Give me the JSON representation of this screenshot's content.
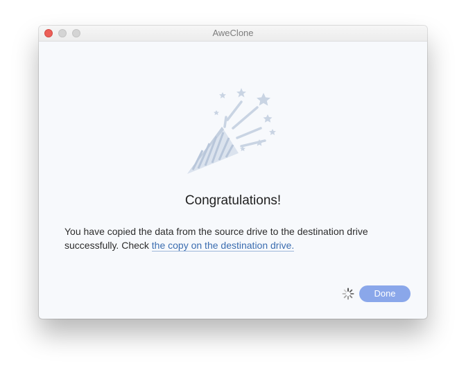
{
  "window": {
    "title": "AweClone"
  },
  "content": {
    "illustration_icon": "party-popper-icon",
    "heading": "Congratulations!",
    "message_prefix": "You have copied the data from the source drive to the destination drive successfully. Check ",
    "link_text": "the copy on the destination drive."
  },
  "footer": {
    "spinner_icon": "loading-spinner-icon",
    "done_label": "Done"
  },
  "colors": {
    "accent": "#8aa7ea",
    "link": "#3b6db0",
    "close": "#ec5f58",
    "background": "#f7f9fc"
  }
}
